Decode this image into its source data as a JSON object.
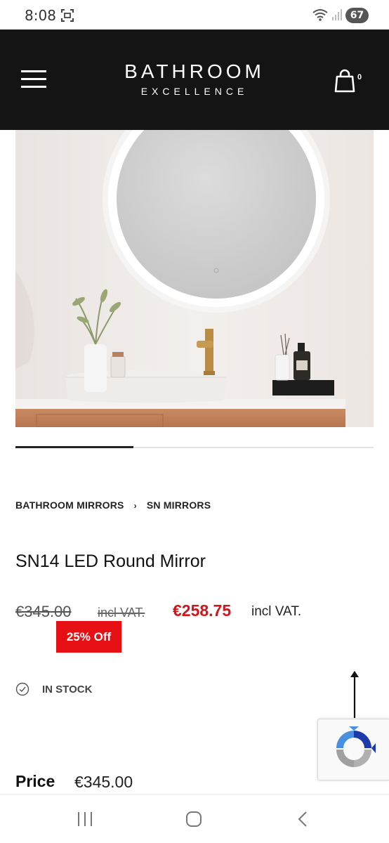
{
  "status_bar": {
    "time": "8:08",
    "battery": "67",
    "icons": [
      "screenshot-icon",
      "wifi-icon",
      "signal-icon",
      "battery-icon"
    ]
  },
  "header": {
    "logo_main": "BATHROOM",
    "logo_sub": "EXCELLENCE",
    "cart_count": "0",
    "icons": [
      "menu-icon",
      "cart-bag-icon"
    ]
  },
  "gallery": {
    "image": "round-led-mirror-bathroom-photo",
    "progress_fraction": 0.33
  },
  "breadcrumb": {
    "items": [
      "BATHROOM MIRRORS",
      "SN MIRRORS"
    ],
    "separator": "›"
  },
  "product": {
    "title": "SN14 LED Round Mirror",
    "old_price": "€345.00",
    "old_vat": "incl VAT.",
    "new_price": "€258.75",
    "new_vat": "incl VAT.",
    "discount": "25% Off",
    "stock_status": "IN STOCK",
    "price_label": "Price",
    "price_value": "€345.00"
  },
  "colors": {
    "header_bg": "#141414",
    "sale_red": "#d0161c",
    "badge_red": "#e60f14"
  },
  "nav_bar": {
    "icons": [
      "recents-icon",
      "home-icon",
      "back-icon"
    ]
  }
}
